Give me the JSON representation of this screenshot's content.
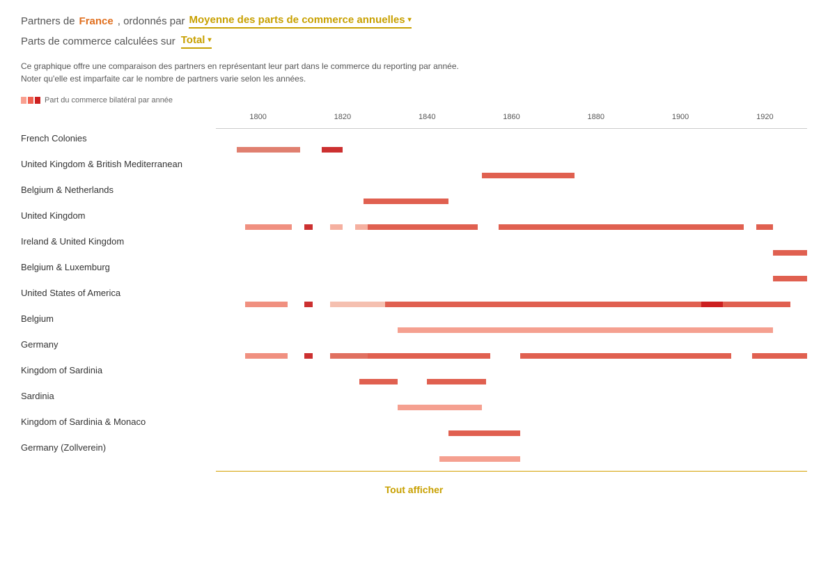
{
  "header": {
    "prefix": "Partners de",
    "country": "France",
    "middle": ", ordonnés par",
    "sort_label": "Moyenne des parts de commerce annuelles",
    "line2_prefix": "Parts de commerce calculées sur",
    "total_label": "Total"
  },
  "description": {
    "line1": "Ce graphique offre une comparaison des partners en représentant leur part dans le commerce du reporting par année.",
    "line2": "Noter qu'elle est imparfaite car le nombre de partners varie selon les années."
  },
  "legend": {
    "label": "Part du commerce bilatéral par année"
  },
  "years": [
    "1800",
    "1820",
    "1840",
    "1860",
    "1880",
    "1900",
    "1920"
  ],
  "year_start": 1790,
  "year_end": 1930,
  "partners": [
    {
      "name": "French Colonies",
      "bars": [
        {
          "start": 1795,
          "end": 1810,
          "color": "#e08070"
        },
        {
          "start": 1815,
          "end": 1820,
          "color": "#cc3030"
        }
      ]
    },
    {
      "name": "United Kingdom & British Mediterranean",
      "bars": [
        {
          "start": 1853,
          "end": 1875,
          "color": "#e06050"
        }
      ]
    },
    {
      "name": "Belgium & Netherlands",
      "bars": [
        {
          "start": 1825,
          "end": 1845,
          "color": "#e06050"
        }
      ]
    },
    {
      "name": "United Kingdom",
      "bars": [
        {
          "start": 1797,
          "end": 1808,
          "color": "#f09080"
        },
        {
          "start": 1811,
          "end": 1813,
          "color": "#cc3030"
        },
        {
          "start": 1817,
          "end": 1820,
          "color": "#f5b0a0"
        },
        {
          "start": 1823,
          "end": 1831,
          "color": "#f5b0a0"
        },
        {
          "start": 1835,
          "end": 1836,
          "color": "#f5b0a0"
        },
        {
          "start": 1826,
          "end": 1852,
          "color": "#e06050"
        },
        {
          "start": 1857,
          "end": 1915,
          "color": "#e06050"
        },
        {
          "start": 1918,
          "end": 1922,
          "color": "#e06050"
        }
      ]
    },
    {
      "name": "Ireland & United Kingdom",
      "bars": [
        {
          "start": 1922,
          "end": 1930,
          "color": "#e06050"
        }
      ]
    },
    {
      "name": "Belgium & Luxemburg",
      "bars": [
        {
          "start": 1922,
          "end": 1930,
          "color": "#e06050"
        }
      ]
    },
    {
      "name": "United States of America",
      "bars": [
        {
          "start": 1797,
          "end": 1807,
          "color": "#f09080"
        },
        {
          "start": 1811,
          "end": 1813,
          "color": "#cc3030"
        },
        {
          "start": 1817,
          "end": 1830,
          "color": "#f5c0b0"
        },
        {
          "start": 1835,
          "end": 1840,
          "color": "#f5c0b0"
        },
        {
          "start": 1830,
          "end": 1926,
          "color": "#e06050"
        },
        {
          "start": 1905,
          "end": 1910,
          "color": "#cc2020"
        }
      ]
    },
    {
      "name": "Belgium",
      "bars": [
        {
          "start": 1833,
          "end": 1922,
          "color": "#f5a090"
        }
      ]
    },
    {
      "name": "Germany",
      "bars": [
        {
          "start": 1797,
          "end": 1807,
          "color": "#f09080"
        },
        {
          "start": 1811,
          "end": 1813,
          "color": "#cc3030"
        },
        {
          "start": 1817,
          "end": 1830,
          "color": "#e07060"
        },
        {
          "start": 1826,
          "end": 1855,
          "color": "#e06050"
        },
        {
          "start": 1862,
          "end": 1912,
          "color": "#e06050"
        },
        {
          "start": 1917,
          "end": 1930,
          "color": "#e06050"
        }
      ]
    },
    {
      "name": "Kingdom of Sardinia",
      "bars": [
        {
          "start": 1824,
          "end": 1833,
          "color": "#e06050"
        },
        {
          "start": 1840,
          "end": 1854,
          "color": "#e06050"
        }
      ]
    },
    {
      "name": "Sardinia",
      "bars": [
        {
          "start": 1833,
          "end": 1853,
          "color": "#f5a090"
        }
      ]
    },
    {
      "name": "Kingdom of Sardinia & Monaco",
      "bars": [
        {
          "start": 1845,
          "end": 1862,
          "color": "#e06050"
        }
      ]
    },
    {
      "name": "Germany (Zollverein)",
      "bars": [
        {
          "start": 1843,
          "end": 1862,
          "color": "#f5a090"
        }
      ]
    }
  ],
  "show_all_label": "Tout afficher"
}
